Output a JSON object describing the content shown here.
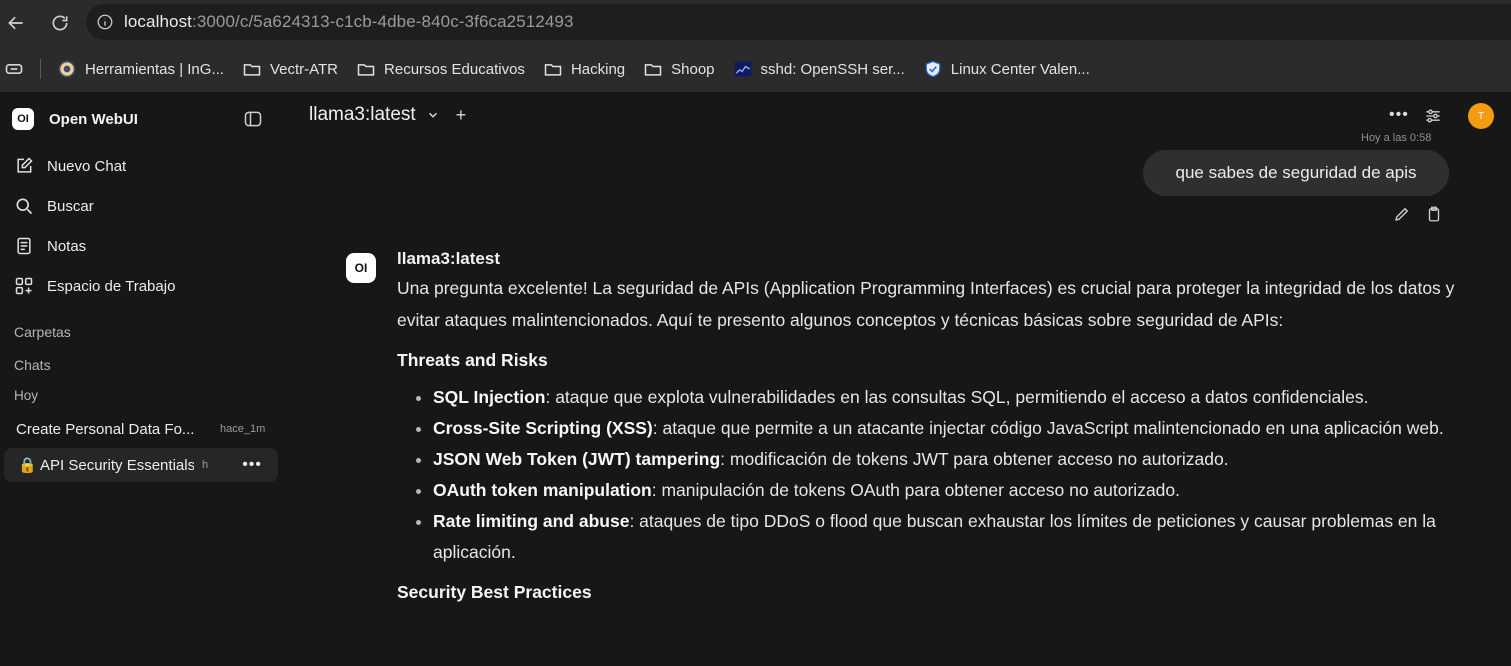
{
  "browser": {
    "url_host": "localhost",
    "url_rest": ":3000/c/5a624313-c1cb-4dbe-840c-3f6ca2512493",
    "bookmarks": [
      {
        "label": "Herramientas | InG...",
        "icon": "shield-badge-icon"
      },
      {
        "label": "Vectr-ATR",
        "icon": "folder-icon"
      },
      {
        "label": "Recursos Educativos",
        "icon": "folder-icon"
      },
      {
        "label": "Hacking",
        "icon": "folder-icon"
      },
      {
        "label": "Shoop",
        "icon": "folder-icon"
      },
      {
        "label": "sshd: OpenSSH ser...",
        "icon": "chart-favicon-icon"
      },
      {
        "label": "Linux Center Valen...",
        "icon": "shield-favicon-icon"
      }
    ]
  },
  "sidebar": {
    "brand_logo": "OI",
    "brand_name": "Open WebUI",
    "nav": [
      {
        "label": "Nuevo Chat",
        "icon": "edit-icon"
      },
      {
        "label": "Buscar",
        "icon": "search-icon"
      },
      {
        "label": "Notas",
        "icon": "notes-icon"
      },
      {
        "label": "Espacio de Trabajo",
        "icon": "workspace-icon"
      }
    ],
    "folders_label": "Carpetas",
    "chats_label": "Chats",
    "today_label": "Hoy",
    "chats": [
      {
        "title": "Create Personal Data Fo...",
        "time": "hace_1m",
        "active": false
      },
      {
        "title": "🔒 API Security Essentials",
        "time": "h",
        "active": true
      }
    ]
  },
  "main": {
    "model": "llama3:latest",
    "avatar_initial": "T",
    "timestamp": "Hoy a las 0:58",
    "user_message": "que sabes de seguridad de apis",
    "assistant": {
      "logo": "OI",
      "name": "llama3:latest",
      "intro": "Una pregunta excelente! La seguridad de APIs (Application Programming Interfaces) es crucial para proteger la integridad de los datos y evitar ataques malintencionados. Aquí te presento algunos conceptos y técnicas básicas sobre seguridad de APIs:",
      "heading1": "Threats and Risks",
      "threats": [
        {
          "term": "SQL Injection",
          "desc": ": ataque que explota vulnerabilidades en las consultas SQL, permitiendo el acceso a datos confidenciales."
        },
        {
          "term": "Cross-Site Scripting (XSS)",
          "desc": ": ataque que permite a un atacante injectar código JavaScript malintencionado en una aplicación web."
        },
        {
          "term": "JSON Web Token (JWT) tampering",
          "desc": ": modificación de tokens JWT para obtener acceso no autorizado."
        },
        {
          "term": "OAuth token manipulation",
          "desc": ": manipulación de tokens OAuth para obtener acceso no autorizado."
        },
        {
          "term": "Rate limiting and abuse",
          "desc": ": ataques de tipo DDoS o flood que buscan exhaustar los límites de peticiones y causar problemas en la aplicación."
        }
      ],
      "heading2": "Security Best Practices"
    }
  }
}
